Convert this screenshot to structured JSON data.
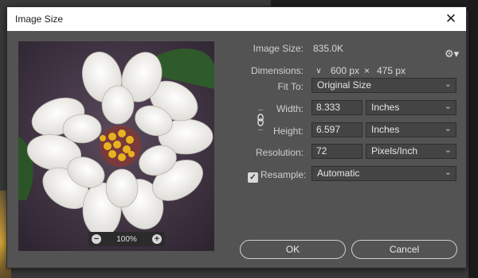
{
  "dialog": {
    "title": "Image Size"
  },
  "preview": {
    "zoom": "100%",
    "zoom_out_glyph": "−",
    "zoom_in_glyph": "+"
  },
  "info": {
    "image_size_label": "Image Size:",
    "image_size_value": "835.0K",
    "dimensions_label": "Dimensions:",
    "dim_width": "600 px",
    "dim_times": "×",
    "dim_height": "475 px"
  },
  "fields": {
    "fit_to_label": "Fit To:",
    "fit_to_value": "Original Size",
    "width_label": "Width:",
    "width_value": "8.333",
    "width_unit": "Inches",
    "height_label": "Height:",
    "height_value": "6.597",
    "height_unit": "Inches",
    "resolution_label": "Resolution:",
    "resolution_value": "72",
    "resolution_unit": "Pixels/Inch",
    "resample_label": "Resample:",
    "resample_value": "Automatic",
    "resample_checked": true
  },
  "buttons": {
    "ok": "OK",
    "cancel": "Cancel"
  },
  "icons": {
    "close": "close-icon",
    "settings": "gear-icon",
    "link": "chain-link-icon",
    "chevron": "chevron-down-icon",
    "zoom_out": "zoom-out-icon",
    "zoom_in": "zoom-in-icon",
    "checkbox": "checkmark-icon"
  },
  "colors": {
    "dialog_bg": "#535353",
    "field_bg": "#444444",
    "titlebar_bg": "#ffffff"
  }
}
